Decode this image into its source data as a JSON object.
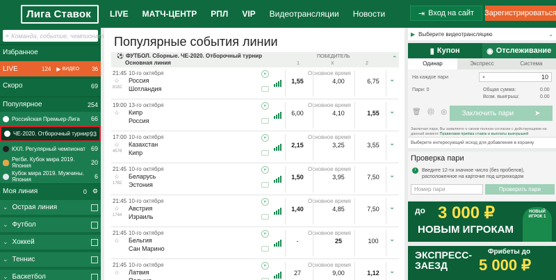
{
  "header": {
    "logo": "Лига Ставок",
    "nav": [
      "LIVE",
      "МАТЧ-ЦЕНТР",
      "РПЛ",
      "VIP",
      "Видеотрансляции",
      "Новости"
    ],
    "login": "Вход на сайт",
    "register": "Зарегистрироваться"
  },
  "sidebar": {
    "search_placeholder": "Команда, событие, чемпионат",
    "favorites": "Избранное",
    "live": {
      "label": "LIVE",
      "count": "124",
      "video": "ВИДЕО",
      "video_count": "36"
    },
    "soon": {
      "label": "Скоро",
      "count": "69"
    },
    "popular": {
      "label": "Популярное",
      "count": "254"
    },
    "popular_items": [
      {
        "label": "Российская Премьер-Лига",
        "count": "66"
      },
      {
        "label": "ЧЕ-2020. Отборочный турнир",
        "count": "93"
      },
      {
        "label": "КХЛ. Регулярный чемпионат",
        "count": "69"
      },
      {
        "label": "Регби. Кубок мира 2019. Япония",
        "count": "20"
      },
      {
        "label": "Кубок мира 2019. Мужчины. Япония",
        "count": "6"
      }
    ],
    "my_line": {
      "label": "Моя линия",
      "count": "0"
    },
    "sports": [
      "Острая линия",
      "Футбол",
      "Хоккей",
      "Теннис",
      "Баскетбол"
    ]
  },
  "main": {
    "title": "Популярные события линии",
    "group": {
      "title": "ФУТБОЛ. Сборные. ЧЕ-2020. Отборочный турнир",
      "subtitle": "Основная линия",
      "col_winner": "ПОБЕДИТЕЛЬ",
      "col1": "1",
      "colx": "X",
      "col2": "2"
    },
    "events": [
      {
        "time": "21:45",
        "id": "8182",
        "date": "10-го октября",
        "team1": "Россия",
        "team2": "Шотландия",
        "market": "Основное время",
        "o1": "1,55",
        "ox": "4,00",
        "o2": "6,75",
        "bold": "1"
      },
      {
        "time": "19:00",
        "id": "",
        "date": "13-го октября",
        "team1": "Кипр",
        "team2": "Россия",
        "market": "Основное время",
        "o1": "6,00",
        "ox": "4,10",
        "o2": "1,55",
        "bold": "2"
      },
      {
        "time": "17:00",
        "id": "4578",
        "date": "10-го октября",
        "team1": "Казахстан",
        "team2": "Кипр",
        "market": "Основное время",
        "o1": "2,15",
        "ox": "3,25",
        "o2": "3,55",
        "bold": "1"
      },
      {
        "time": "21:45",
        "id": "1782",
        "date": "10-го октября",
        "team1": "Беларусь",
        "team2": "Эстония",
        "market": "Основное время",
        "o1": "1,50",
        "ox": "3,95",
        "o2": "7,50",
        "bold": "1"
      },
      {
        "time": "21:45",
        "id": "1744",
        "date": "10-го октября",
        "team1": "Австрия",
        "team2": "Израиль",
        "market": "Основное время",
        "o1": "1,40",
        "ox": "4,85",
        "o2": "7,50",
        "bold": "1"
      },
      {
        "time": "21:45",
        "id": "",
        "date": "10-го октября",
        "team1": "Бельгия",
        "team2": "Сан Марино",
        "market": "Основное время",
        "o1": "-",
        "ox": "25",
        "o2": "100",
        "bold": "x"
      },
      {
        "time": "21:45",
        "id": "",
        "date": "10-го октября",
        "team1": "Латвия",
        "team2": "Польша",
        "market": "Основное время",
        "o1": "27",
        "ox": "9,00",
        "o2": "1,12",
        "bold": "2"
      }
    ]
  },
  "right": {
    "video_select": "Выберите видеотрансляцию",
    "tab_coupon": "Купон",
    "tab_tracking": "Отслеживание",
    "bet_tabs": [
      "Одинар",
      "Экспресс",
      "Система"
    ],
    "per_bet": "На каждое пари",
    "stake": "10",
    "bets_count_label": "Пари: 0",
    "total_label": "Общая сумма:",
    "total_val": "0.00",
    "win_label": "Возм. выигрыш:",
    "win_val": "0.00",
    "make_bet": "Заключить пари",
    "note": "Заключая пари, Вы заявляете о своем полном согласии с действующими на данный момент ",
    "note_link": "Правилами приёма ставок и выплаты выигрышей",
    "hint": "Выберите интересующий исход для добавления в корзину",
    "check_title": "Проверка пари",
    "check_text": "Введите 12-ти значное число (без пробелов), расположенное на карточке под штрихкодом",
    "check_placeholder": "Номер пари",
    "check_button": "Проверить пари",
    "banner1": {
      "prefix": "до",
      "amount": "3 000 ₽",
      "line2": "НОВЫМ ИГРОКАМ",
      "shirt": "НОВЫЙ ИГРОК 1"
    },
    "banner2": {
      "line1": "ЭКСПРЕСС-ЗАЕЗД",
      "freebet": "Фрибеты до",
      "amount": "5 000 ₽"
    }
  },
  "colors": {
    "brand_green": "#0f6b3f",
    "orange": "#e8632d",
    "light_green": "#9fd0b8",
    "active_outline": "#d81f26"
  }
}
